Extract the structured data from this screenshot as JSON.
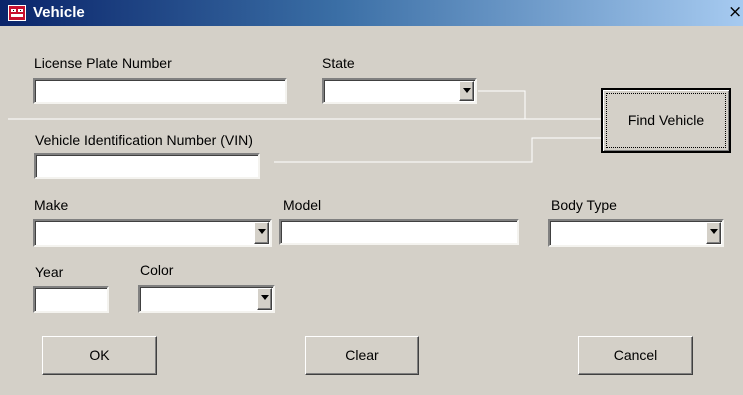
{
  "window": {
    "title": "Vehicle",
    "close_glyph": "×"
  },
  "form": {
    "license_plate_label": "License Plate Number",
    "license_plate_value": "",
    "state_label": "State",
    "state_value": "",
    "vin_label": "Vehicle Identification Number (VIN)",
    "vin_value": "",
    "make_label": "Make",
    "make_value": "",
    "model_label": "Model",
    "model_value": "",
    "body_type_label": "Body Type",
    "body_type_value": "",
    "year_label": "Year",
    "year_value": "",
    "color_label": "Color",
    "color_value": ""
  },
  "buttons": {
    "find_vehicle": "Find Vehicle",
    "ok": "OK",
    "clear": "Clear",
    "cancel": "Cancel"
  },
  "colors": {
    "dialog_bg": "#d4d0c8",
    "title_start": "#0a246a",
    "title_end": "#a6caf0",
    "field_bg": "#ffffff",
    "connector_line": "#ffffff"
  },
  "icons": {
    "title": "vehicle-app-icon",
    "close": "close-icon",
    "dropdown": "chevron-down-icon"
  }
}
